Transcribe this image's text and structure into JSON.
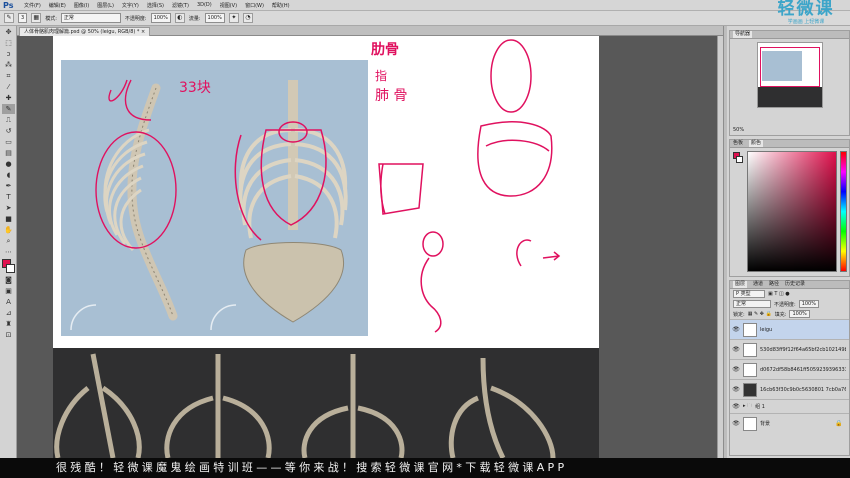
{
  "app": {
    "logo": "Ps"
  },
  "menu": [
    "文件(F)",
    "编辑(E)",
    "图像(I)",
    "图层(L)",
    "文字(Y)",
    "选择(S)",
    "滤镜(T)",
    "3D(D)",
    "视图(V)",
    "窗口(W)",
    "帮助(H)"
  ],
  "options": {
    "brush_size": "3",
    "mode_label": "模式:",
    "mode_value": "正常",
    "opacity_label": "不透明度:",
    "opacity_value": "100%",
    "flow_label": "流量:",
    "flow_value": "100%"
  },
  "watermark": {
    "title": "轻微课",
    "subtitle": "学画画 上轻微课"
  },
  "document": {
    "tab_title": "人体骨骼肌肉理解篇.psd @ 50% (leigu, RGB/8) *"
  },
  "sketch_text": {
    "count": "33块",
    "ribs": "肋骨",
    "rib_detail_1": "指",
    "rib_detail_2": "肺 骨"
  },
  "navigator": {
    "tab": "导航器",
    "zoom": "50%"
  },
  "color_panel": {
    "tabs": [
      "色板",
      "颜色"
    ],
    "fg_color": "#e0114f"
  },
  "layers_panel": {
    "tabs": [
      "图层",
      "通道",
      "路径",
      "历史记录"
    ],
    "filter_label": "P 类型",
    "blend_mode": "正常",
    "opacity_label": "不透明度:",
    "opacity_value": "100%",
    "lock_label": "锁定:",
    "fill_label": "填充:",
    "fill_value": "100%",
    "layers": [
      {
        "name": "leigu",
        "selected": true,
        "dark": false
      },
      {
        "name": "530d83ff9f12f64a65bf2cb102149b...",
        "selected": false,
        "dark": false
      },
      {
        "name": "d0672df58b8461ff5059239396333...",
        "selected": false,
        "dark": false
      },
      {
        "name": "16cb63f30c9b0c5630801 7cb0a76f...",
        "selected": false,
        "dark": true
      },
      {
        "name": "组 1",
        "selected": false,
        "dark": false,
        "group": true
      },
      {
        "name": "背景",
        "selected": false,
        "dark": false,
        "locked": true
      }
    ]
  },
  "banner": {
    "text": "很残酷！轻微课魔鬼绘画特训班——等你来战！搜索轻微课官网*下载轻微课APP"
  }
}
